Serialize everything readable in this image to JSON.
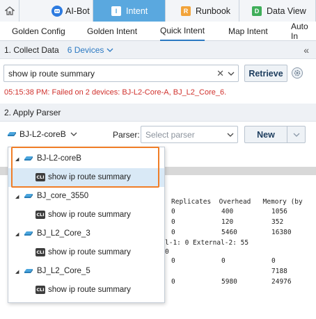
{
  "top_tabs": [
    {
      "label": "AI-Bot",
      "badge_color": "#2d7be0",
      "active": false
    },
    {
      "label": "Intent",
      "badge_color": "#4fa3da",
      "active": true
    },
    {
      "label": "Runbook",
      "badge_color": "#f2a33a",
      "active": false
    },
    {
      "label": "Data View",
      "badge_color": "#3fae5a",
      "active": false
    }
  ],
  "badges": {
    "intent": "I",
    "runbook": "R",
    "dataview": "D"
  },
  "sub_tabs": [
    {
      "label": "Golden Config"
    },
    {
      "label": "Golden Intent"
    },
    {
      "label": "Quick Intent"
    },
    {
      "label": "Map Intent"
    },
    {
      "label": "Auto In"
    }
  ],
  "collect": {
    "title": "1. Collect Data",
    "devices_link": "6 Devices",
    "command_value": "show ip route summary",
    "retrieve_label": "Retrieve",
    "error_text": "05:15:38 PM: Failed on 2 devices: BJ-L2-Core-A, BJ_L2_Core_6."
  },
  "apply": {
    "title": "2. Apply Parser",
    "device_selected": "BJ-L2-coreB",
    "parser_label": "Parser:",
    "parser_placeholder": "Select parser",
    "new_label": "New"
  },
  "tree": {
    "cli_badge": "CLI",
    "items": [
      {
        "device": "BJ-L2-coreB",
        "command": "show ip route summary"
      },
      {
        "device": "BJ_core_3550",
        "command": "show ip route summary"
      },
      {
        "device": "BJ_L2_Core_3",
        "command": "show ip route summary"
      },
      {
        "device": "BJ_L2_Core_5",
        "command": "show ip route summary"
      }
    ]
  },
  "output": {
    "header": "Replicates  Overhead   Memory (by",
    "rows": [
      {
        "c1": "0",
        "c2": "400",
        "c3": "1056"
      },
      {
        "c1": "0",
        "c2": "120",
        "c3": "352"
      },
      {
        "c1": "0",
        "c2": "5460",
        "c3": "16380"
      }
    ],
    "external_line": "l-1: 0 External-2: 55",
    "zero_line": "0",
    "row4": {
      "c1": "0",
      "c2": "0",
      "c3": "0"
    },
    "row5": {
      "c3": "7188"
    },
    "row6": {
      "c1": "0",
      "c2": "5980",
      "c3": "24976"
    }
  },
  "colors": {
    "accent": "#2b79c2",
    "active_tab": "#5aa8df",
    "error": "#d0312d",
    "highlight": "#f07d26"
  }
}
